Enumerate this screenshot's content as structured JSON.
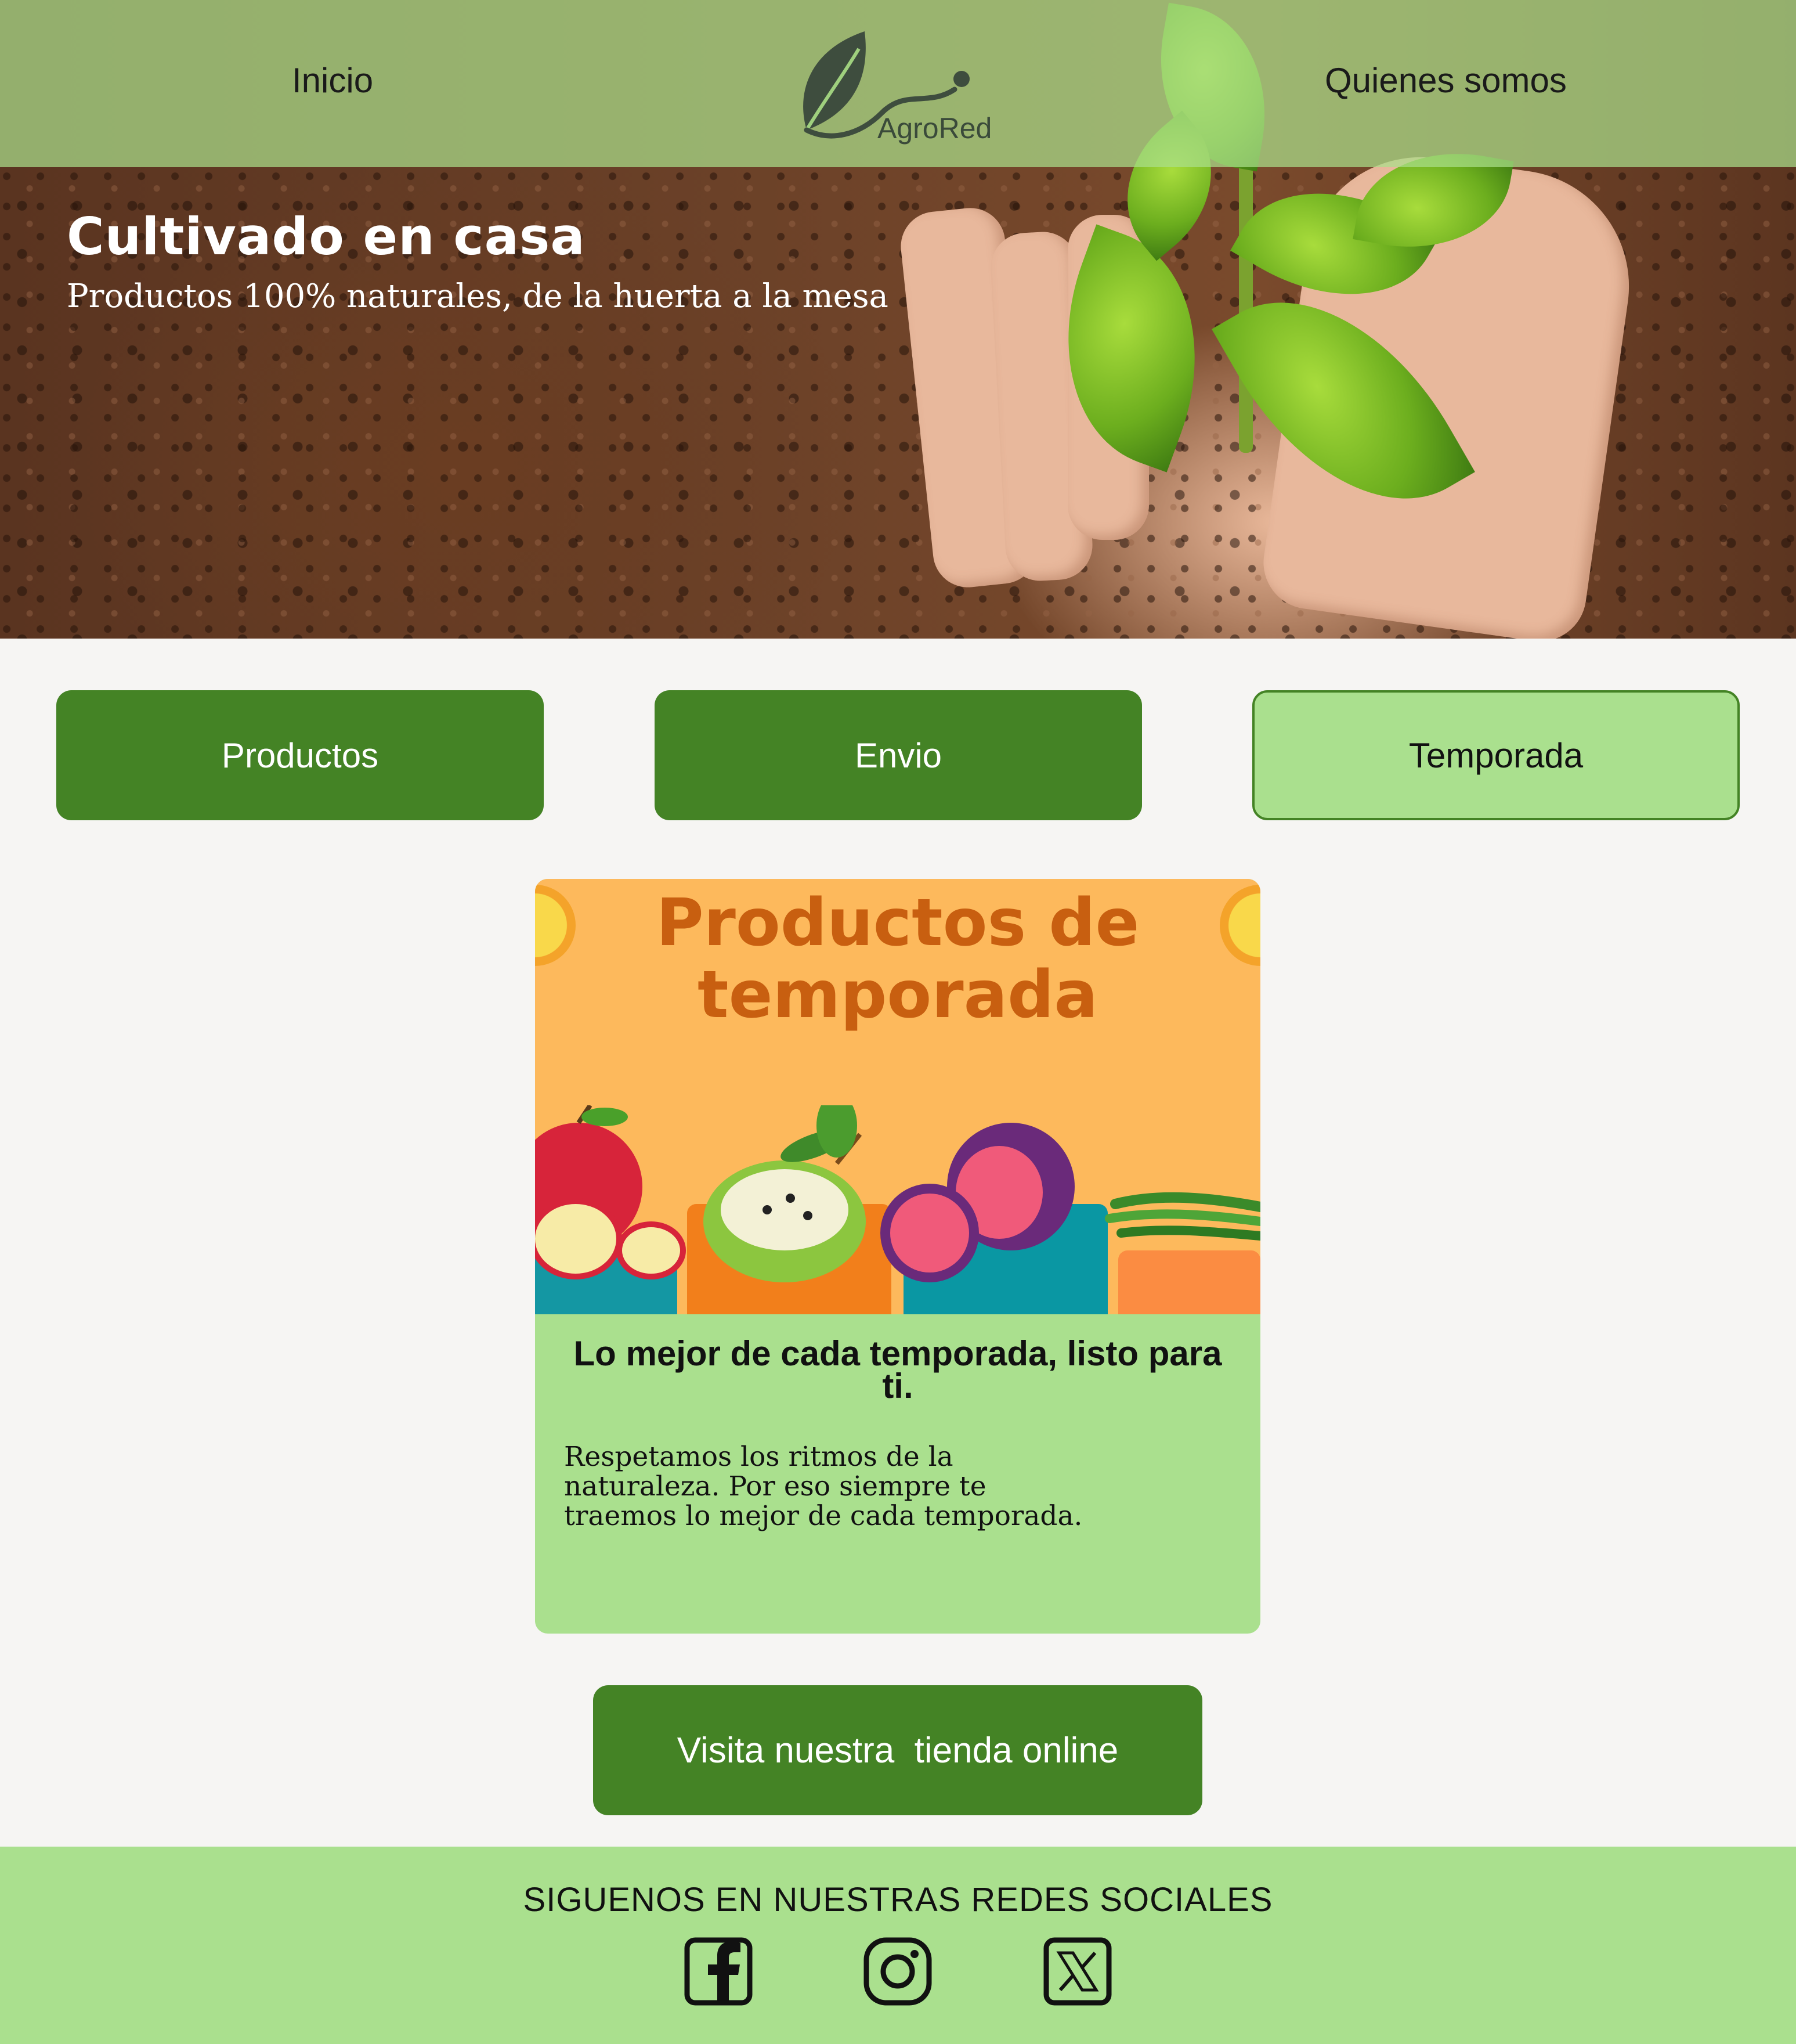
{
  "nav": {
    "left_link": "Inicio",
    "right_link": "Quienes somos",
    "logo_text": "AgroRed"
  },
  "hero": {
    "title": "Cultivado en casa",
    "subtitle": "Productos 100% naturales, de la huerta a la mesa"
  },
  "tabs": [
    {
      "label": "Productos",
      "active": false
    },
    {
      "label": "Envio",
      "active": false
    },
    {
      "label": "Temporada",
      "active": true
    }
  ],
  "card": {
    "image_title_line1": "Productos de",
    "image_title_line2": "temporada",
    "heading": "Lo mejor de cada temporada, listo para ti.",
    "text": "Respetamos los ritmos de la naturaleza. Por eso siempre te traemos lo mejor de cada temporada."
  },
  "cta": {
    "label": "Visita nuestra  tienda online"
  },
  "footer": {
    "title": "SIGUENOS EN NUESTRAS REDES SOCIALES",
    "icons": [
      "facebook-icon",
      "instagram-icon",
      "x-icon"
    ]
  },
  "colors": {
    "primary_green": "#448325",
    "light_green": "#aae08e",
    "background": "#f6f5f3",
    "card_image_bg": "#fdb95c",
    "card_title_orange": "#c85f10"
  }
}
